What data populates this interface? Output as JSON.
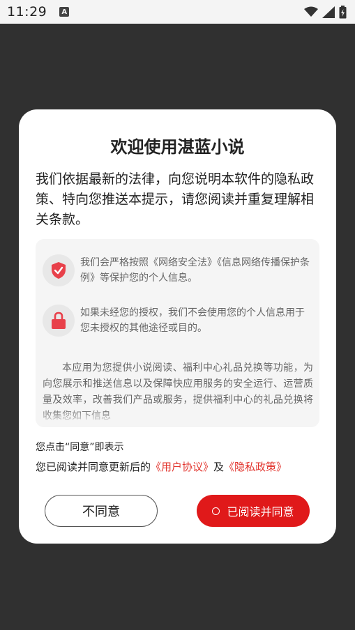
{
  "status_bar": {
    "time": "11:29",
    "notification_icon_letter": "A",
    "icons": [
      "wifi-icon",
      "signal-icon",
      "battery-icon"
    ]
  },
  "dialog": {
    "title": "欢迎使用湛蓝小说",
    "intro": "我们依据最新的法律，向您说明本软件的隐私政策、特向您推送本提示，请您阅读并重复理解相关条款。",
    "info_items": [
      {
        "icon": "shield-icon",
        "text": "我们会严格按照《网络安全法》《信息网络传播保护条例》等保护您的个人信息。"
      },
      {
        "icon": "lock-icon",
        "text": "如果未经您的授权，我们不会使用您的个人信息用于您未授权的其他途径或目的。"
      }
    ],
    "body": "本应用为您提供小说阅读、福利中心礼品兑换等功能，为向您展示和推送信息以及保障快应用服务的安全运行、运营质量及效率，改善我们产品或服务，提供福利中心的礼品兑换将收集您如下信息",
    "consent_prefix": "您点击“同意”即表示",
    "consent_text": "您已阅读并同意更新后的",
    "user_agreement_link": "《用户协议》",
    "and": "及",
    "privacy_policy_link": "《隐私政策》",
    "disagree_label": "不同意",
    "agree_label": "已阅读并同意"
  },
  "colors": {
    "accent": "#e0191a",
    "link": "#e2342d",
    "overlay": "#303030"
  }
}
